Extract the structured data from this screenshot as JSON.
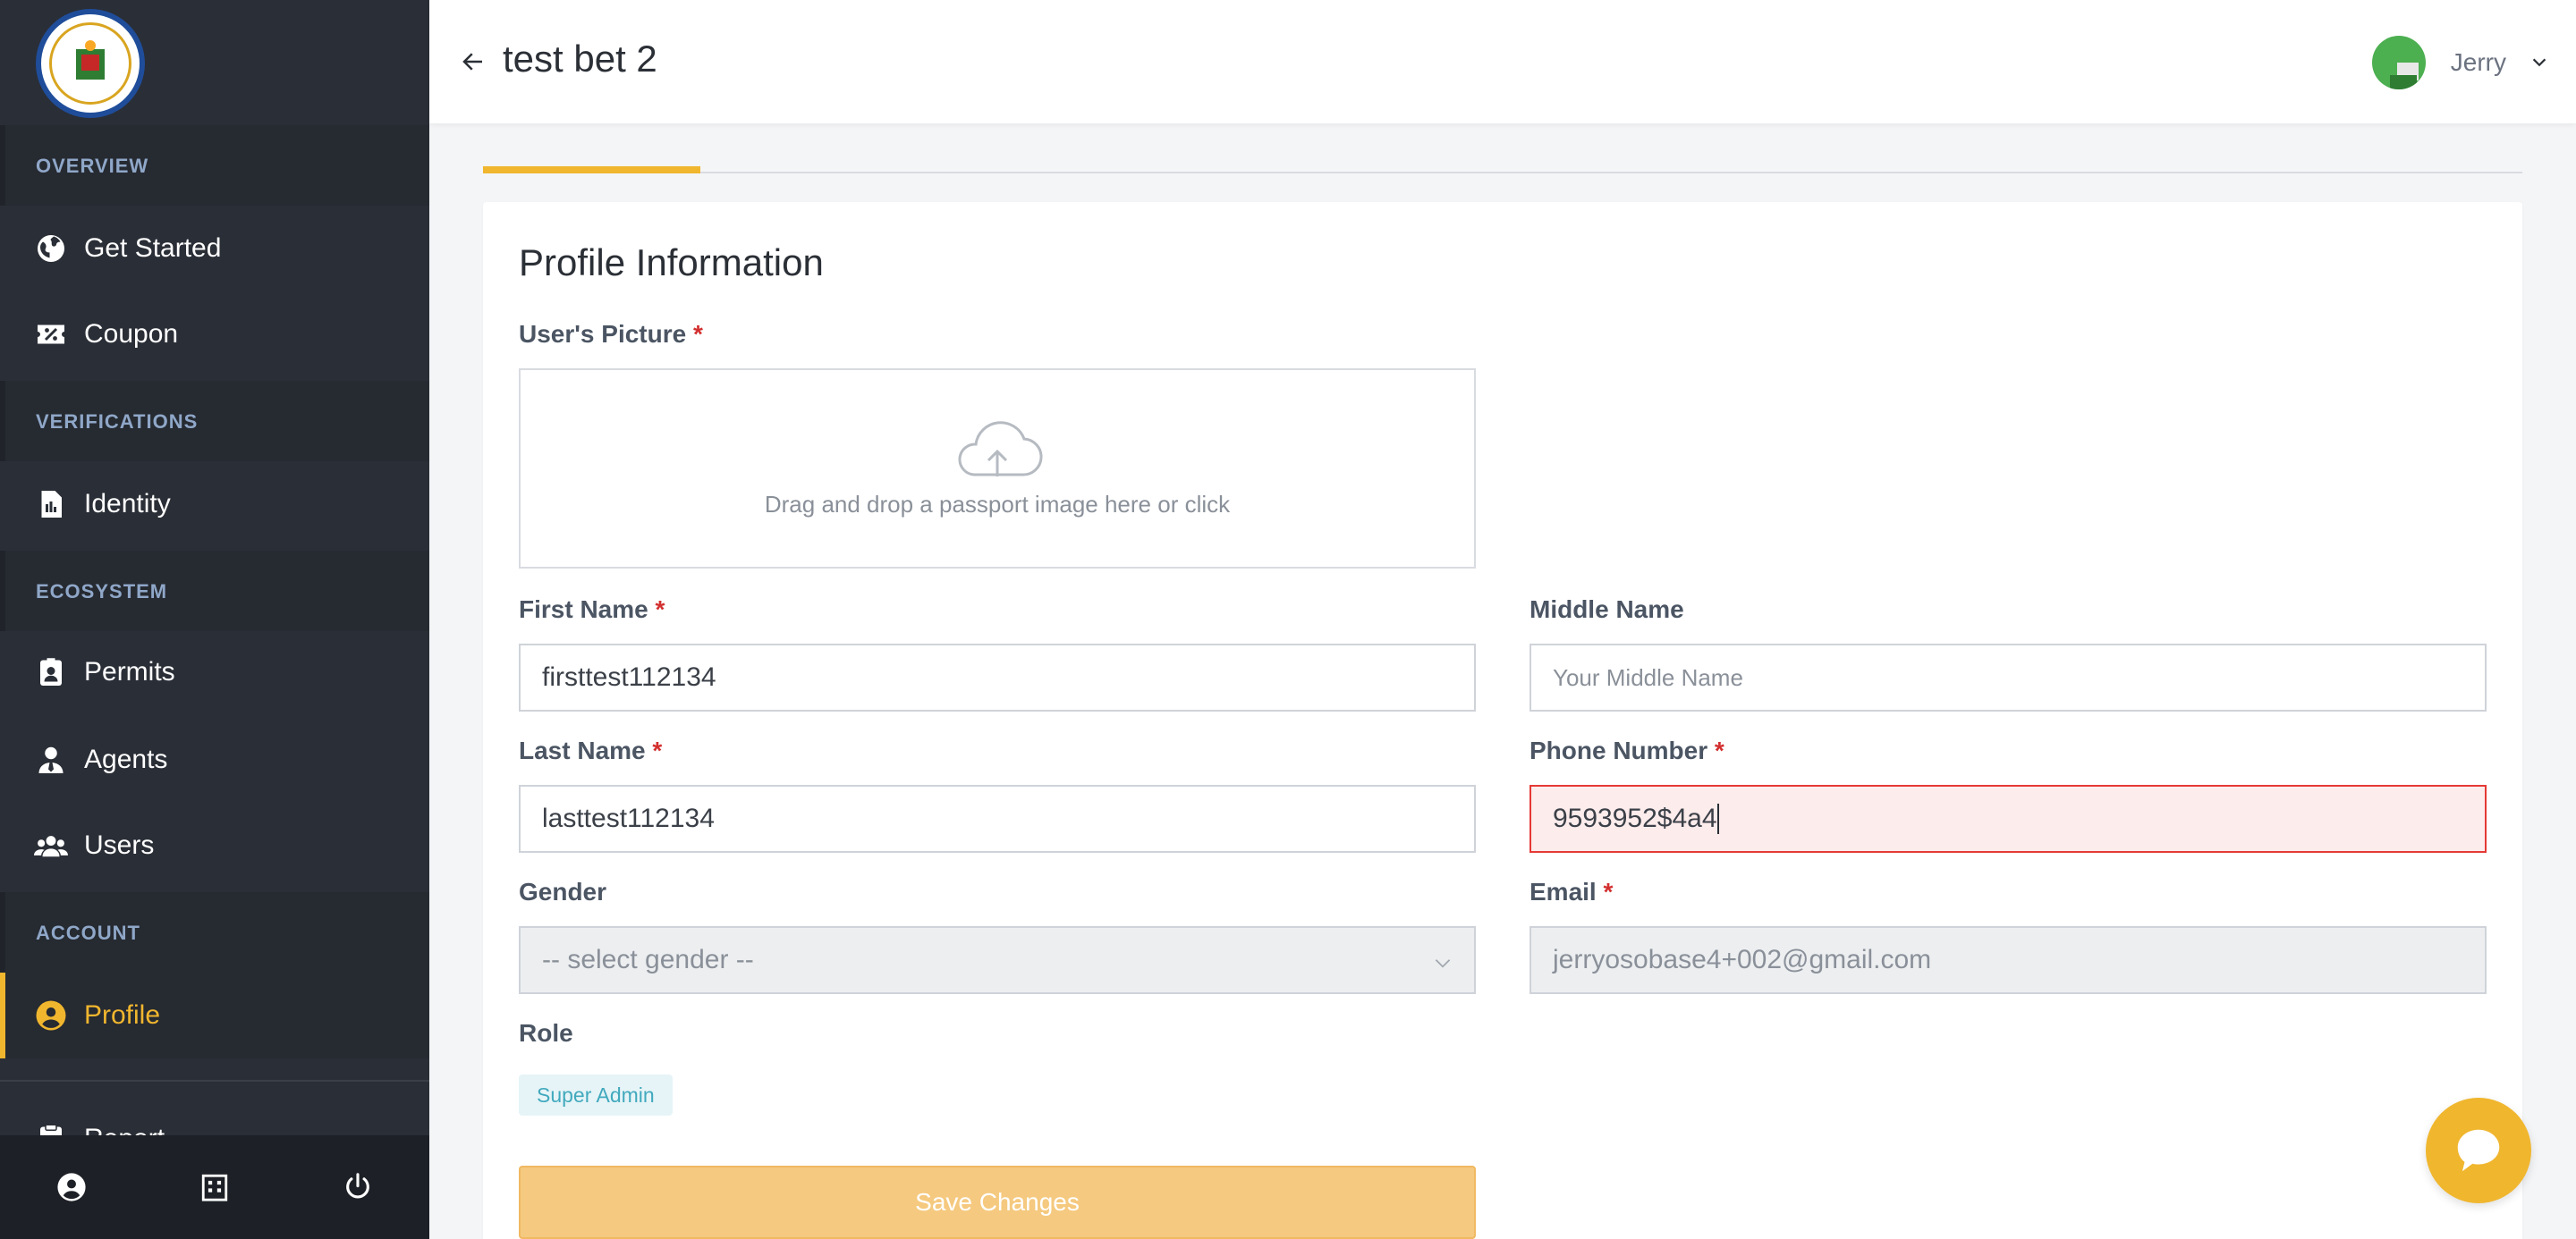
{
  "header": {
    "title": "test bet 2",
    "user_name": "Jerry"
  },
  "sidebar": {
    "sections": [
      {
        "label": "OVERVIEW"
      },
      {
        "label": "VERIFICATIONS"
      },
      {
        "label": "ECOSYSTEM"
      },
      {
        "label": "ACCOUNT"
      }
    ],
    "items": [
      {
        "label": "Get Started",
        "icon": "globe-icon"
      },
      {
        "label": "Coupon",
        "icon": "coupon-icon"
      },
      {
        "label": "Identity",
        "icon": "document-icon"
      },
      {
        "label": "Permits",
        "icon": "id-badge-icon"
      },
      {
        "label": "Agents",
        "icon": "agent-icon"
      },
      {
        "label": "Users",
        "icon": "users-icon"
      },
      {
        "label": "Profile",
        "icon": "user-circle-icon",
        "active": true
      },
      {
        "label": "Report",
        "icon": "clipboard-icon"
      }
    ],
    "footer_icons": [
      "user-circle-icon",
      "building-icon",
      "power-icon"
    ]
  },
  "form": {
    "title": "Profile Information",
    "picture_label": "User's Picture",
    "dropzone_text": "Drag and drop a passport image here or click",
    "first_name_label": "First Name",
    "first_name_value": "firsttest112134",
    "middle_name_label": "Middle Name",
    "middle_name_placeholder": "Your Middle Name",
    "last_name_label": "Last Name",
    "last_name_value": "lasttest112134",
    "phone_label": "Phone Number",
    "phone_value": "9593952$4a4",
    "gender_label": "Gender",
    "gender_value": "-- select gender --",
    "email_label": "Email",
    "email_value": "jerryosobase4+002@gmail.com",
    "role_label": "Role",
    "role_value": "Super Admin",
    "save_label": "Save Changes",
    "required_mark": "*"
  },
  "colors": {
    "accent": "#f0b62e",
    "sidebar_bg": "#2a2e36",
    "error": "#e53935"
  }
}
